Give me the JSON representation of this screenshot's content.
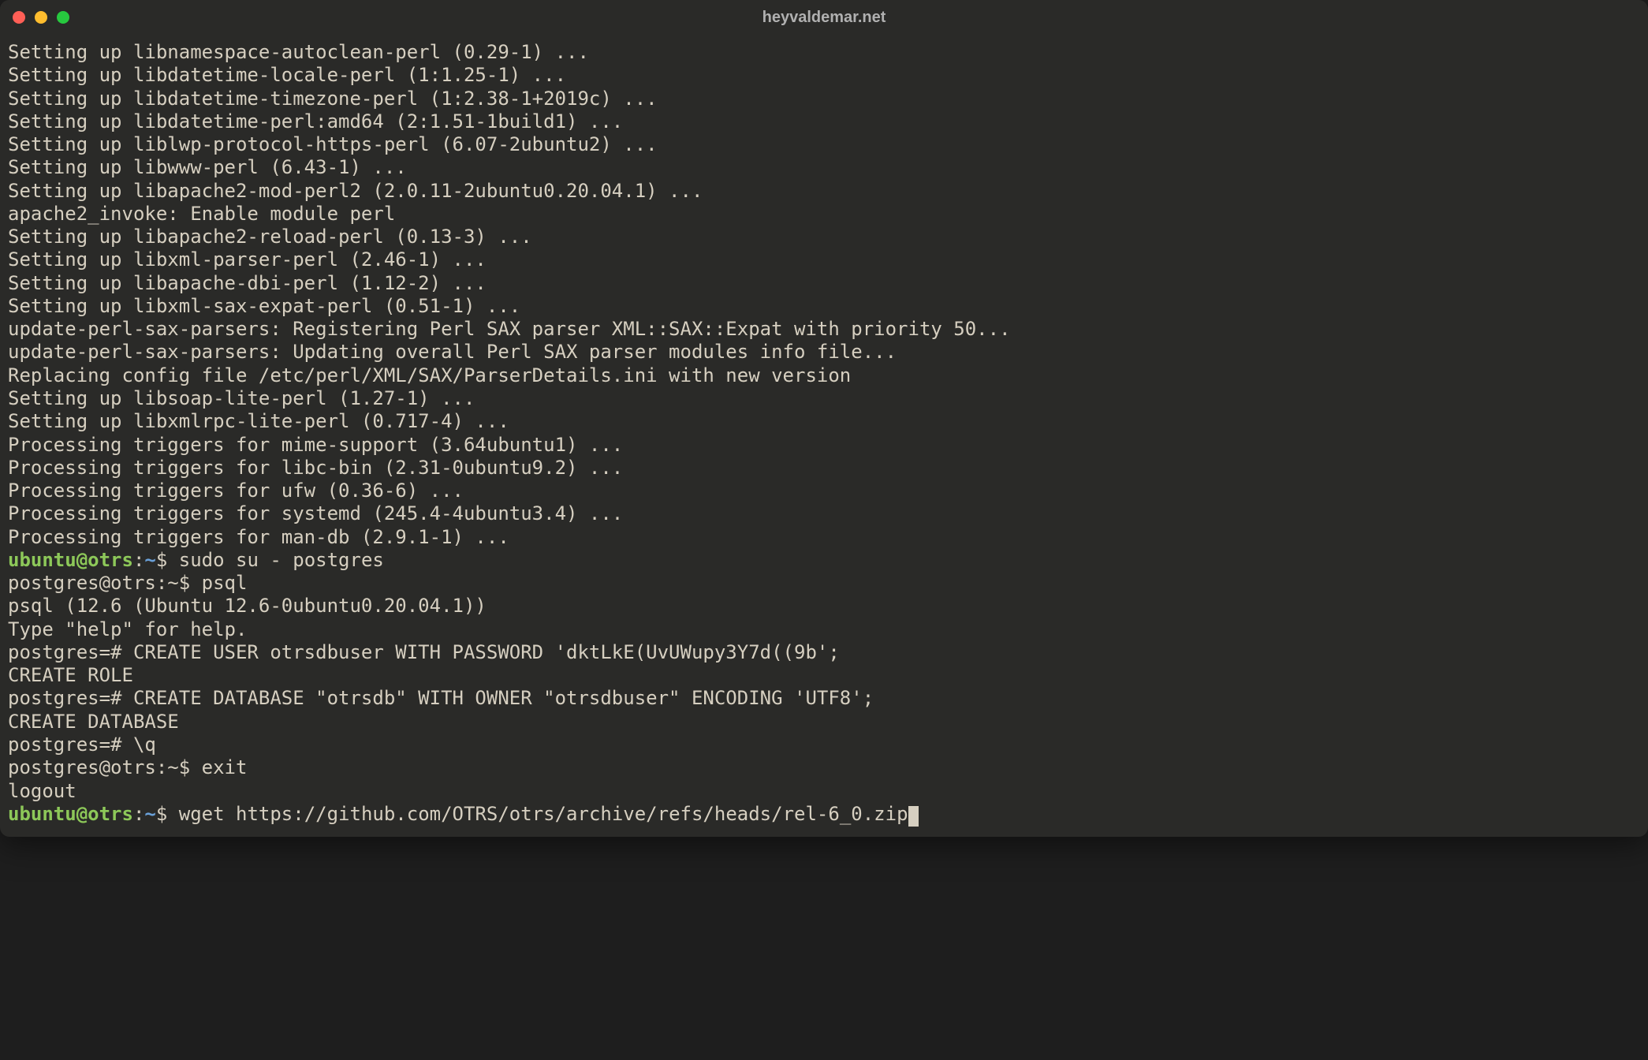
{
  "window": {
    "title": "heyvaldemar.net"
  },
  "output_lines": [
    "Setting up libnamespace-autoclean-perl (0.29-1) ...",
    "Setting up libdatetime-locale-perl (1:1.25-1) ...",
    "Setting up libdatetime-timezone-perl (1:2.38-1+2019c) ...",
    "Setting up libdatetime-perl:amd64 (2:1.51-1build1) ...",
    "Setting up liblwp-protocol-https-perl (6.07-2ubuntu2) ...",
    "Setting up libwww-perl (6.43-1) ...",
    "Setting up libapache2-mod-perl2 (2.0.11-2ubuntu0.20.04.1) ...",
    "apache2_invoke: Enable module perl",
    "Setting up libapache2-reload-perl (0.13-3) ...",
    "Setting up libxml-parser-perl (2.46-1) ...",
    "Setting up libapache-dbi-perl (1.12-2) ...",
    "Setting up libxml-sax-expat-perl (0.51-1) ...",
    "update-perl-sax-parsers: Registering Perl SAX parser XML::SAX::Expat with priority 50...",
    "update-perl-sax-parsers: Updating overall Perl SAX parser modules info file...",
    "Replacing config file /etc/perl/XML/SAX/ParserDetails.ini with new version",
    "Setting up libsoap-lite-perl (1.27-1) ...",
    "Setting up libxmlrpc-lite-perl (0.717-4) ...",
    "Processing triggers for mime-support (3.64ubuntu1) ...",
    "Processing triggers for libc-bin (2.31-0ubuntu9.2) ...",
    "Processing triggers for ufw (0.36-6) ...",
    "Processing triggers for systemd (245.4-4ubuntu3.4) ...",
    "Processing triggers for man-db (2.9.1-1) ..."
  ],
  "prompts": {
    "p1": {
      "user": "ubuntu",
      "host": "otrs",
      "path": "~",
      "symbol": "$",
      "command": "sudo su - postgres"
    },
    "p2_plain": "postgres@otrs:~$ psql",
    "psql_lines": [
      "psql (12.6 (Ubuntu 12.6-0ubuntu0.20.04.1))",
      "Type \"help\" for help.",
      "",
      "postgres=# CREATE USER otrsdbuser WITH PASSWORD 'dktLkE(UvUWupy3Y7d((9b';",
      "CREATE ROLE",
      "postgres=# CREATE DATABASE \"otrsdb\" WITH OWNER \"otrsdbuser\" ENCODING 'UTF8';",
      "CREATE DATABASE",
      "postgres=# \\q",
      "postgres@otrs:~$ exit",
      "logout"
    ],
    "p3": {
      "user": "ubuntu",
      "host": "otrs",
      "path": "~",
      "symbol": "$",
      "command": "wget https://github.com/OTRS/otrs/archive/refs/heads/rel-6_0.zip"
    }
  }
}
